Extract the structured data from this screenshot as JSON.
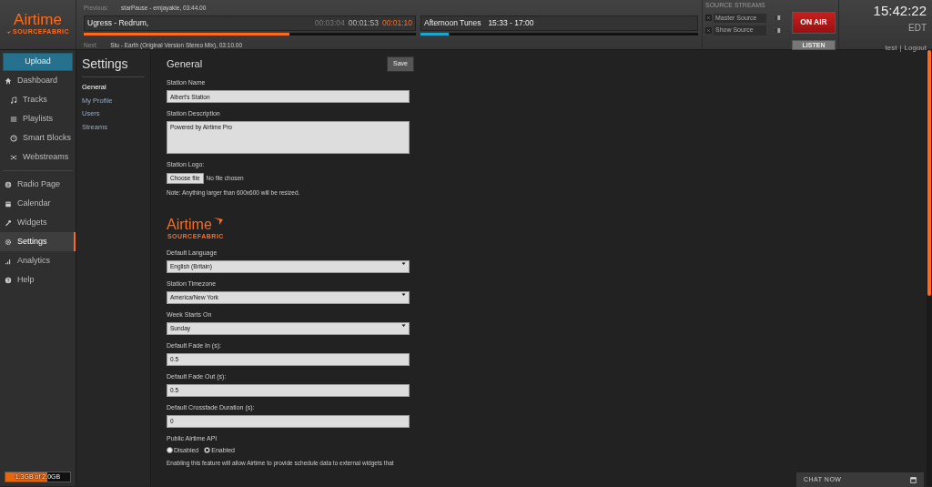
{
  "header": {
    "logo": {
      "text": "Airtime",
      "sub": "SOURCEFABRIC"
    },
    "player": {
      "previous_label": "Previous:",
      "previous": "starPause - emjayakle, 03:44.00",
      "track": "Ugress - Redrum,",
      "times": [
        {
          "text": "00:03:04",
          "kind": "total"
        },
        {
          "text": "00:01:53",
          "kind": "elapsed"
        },
        {
          "text": "00:01:10",
          "kind": "remaining"
        }
      ],
      "track_progress": {
        "level": 0.62
      },
      "next_label": "Next:",
      "next": "Stu - Earth (Original Version Stereo Mix), 03:10.00",
      "show": "Afternoon Tunes",
      "show_time": "15:33 - 17:00",
      "show_progress": {
        "level": 0.1
      }
    },
    "source_streams": {
      "title": "SOURCE STREAMS",
      "sources": [
        {
          "name": "Master Source"
        },
        {
          "name": "Show Source"
        }
      ]
    },
    "on_air": {
      "label": "ON AIR",
      "listen": "LISTEN"
    },
    "clock": {
      "time": "15:42:22",
      "zone": "EDT",
      "user": "test",
      "separator": "|",
      "logout": "Logout"
    }
  },
  "sidebar": {
    "upload": "Upload",
    "items": [
      {
        "label": "Dashboard",
        "selected": false,
        "children": [
          {
            "label": "Tracks",
            "selected": false
          },
          {
            "label": "Playlists",
            "selected": false
          },
          {
            "label": "Smart Blocks",
            "selected": false
          },
          {
            "label": "Webstreams",
            "selected": false
          }
        ]
      },
      {
        "label": "Radio Page",
        "selected": false
      },
      {
        "label": "Calendar",
        "selected": false
      },
      {
        "label": "Widgets",
        "selected": false
      },
      {
        "label": "Settings",
        "selected": true
      },
      {
        "label": "Analytics",
        "selected": false
      },
      {
        "label": "Help",
        "selected": false
      }
    ],
    "storage": {
      "text": "1.3GB of 2.0GB",
      "level": 0.65
    }
  },
  "submenu": {
    "title": "Settings",
    "items": [
      {
        "label": "General",
        "selected": true
      },
      {
        "label": "My Profile",
        "selected": false
      },
      {
        "label": "Users",
        "selected": false
      },
      {
        "label": "Streams",
        "selected": false
      }
    ]
  },
  "form": {
    "title": "General",
    "save": "Save",
    "fields": [
      {
        "kind": "text",
        "label": "Station Name",
        "value": "Albert's Station"
      },
      {
        "kind": "textarea",
        "label": "Station Description",
        "value": "Powered by Airtime Pro"
      },
      {
        "kind": "file",
        "label": "Station Logo:",
        "button": "Choose file",
        "status": "No file chosen",
        "note": "Note: Anything larger than 600x600 will be resized."
      },
      {
        "kind": "logo",
        "text": "Airtime",
        "sub": "SOURCEFABRIC"
      },
      {
        "kind": "select",
        "label": "Default Language",
        "value": "English (Britain)"
      },
      {
        "kind": "select",
        "label": "Station Timezone",
        "value": "America/New York"
      },
      {
        "kind": "select",
        "label": "Week Starts On",
        "value": "Sunday"
      },
      {
        "kind": "text",
        "label": "Default Fade In (s):",
        "value": "0.5"
      },
      {
        "kind": "text",
        "label": "Default Fade Out (s):",
        "value": "0.5"
      },
      {
        "kind": "text",
        "label": "Default Crossfade Duration (s):",
        "value": "0"
      },
      {
        "kind": "radio",
        "label": "Public Airtime API",
        "options": [
          {
            "label": "Disabled",
            "selected": false
          },
          {
            "label": "Enabled",
            "selected": true
          }
        ]
      },
      {
        "kind": "paragraph",
        "text": "Enabling this feature will allow Airtime to provide schedule data to external widgets that"
      }
    ]
  },
  "chat": {
    "label": "CHAT NOW"
  }
}
